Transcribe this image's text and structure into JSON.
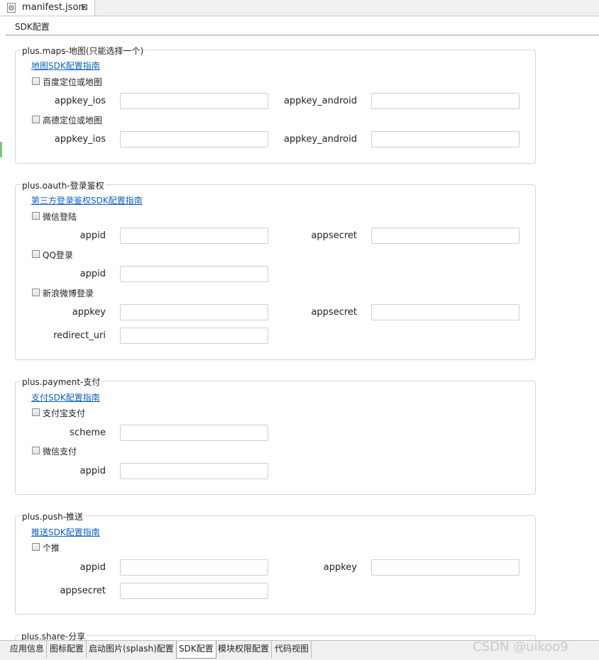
{
  "editor": {
    "tab_title": "manifest.json",
    "close_glyph": "⊠",
    "section_title": "SDK配置"
  },
  "maps": {
    "legend": "plus.maps-地图(只能选择一个)",
    "guide_link": "地图SDK配置指南",
    "baidu": {
      "label": "百度定位或地图",
      "appkey_ios": "appkey_ios",
      "appkey_android": "appkey_android"
    },
    "amap": {
      "label": "高德定位或地图",
      "appkey_ios": "appkey_ios",
      "appkey_android": "appkey_android"
    }
  },
  "oauth": {
    "legend": "plus.oauth-登录鉴权",
    "guide_link": "第三方登录鉴权SDK配置指南",
    "weixin": {
      "label": "微信登陆",
      "appid": "appid",
      "appsecret": "appsecret"
    },
    "qq": {
      "label": "QQ登录",
      "appid": "appid"
    },
    "sina": {
      "label": "新浪微博登录",
      "appkey": "appkey",
      "appsecret": "appsecret",
      "redirect_uri": "redirect_uri"
    }
  },
  "payment": {
    "legend": "plus.payment-支付",
    "guide_link": "支付SDK配置指南",
    "alipay": {
      "label": "支付宝支付",
      "scheme": "scheme"
    },
    "wxpay": {
      "label": "微信支付",
      "appid": "appid"
    }
  },
  "push": {
    "legend": "plus.push-推送",
    "guide_link": "推送SDK配置指南",
    "getui": {
      "label": "个推",
      "appid": "appid",
      "appkey": "appkey",
      "appsecret": "appsecret"
    }
  },
  "share": {
    "legend": "plus.share-分享"
  },
  "bottom_tabs": {
    "app_info": "应用信息",
    "icon": "图标配置",
    "splash": "启动图片(splash)配置",
    "sdk": "SDK配置",
    "permissions": "模块权限配置",
    "code_view": "代码视图"
  },
  "watermark": "CSDN @uikoo9"
}
